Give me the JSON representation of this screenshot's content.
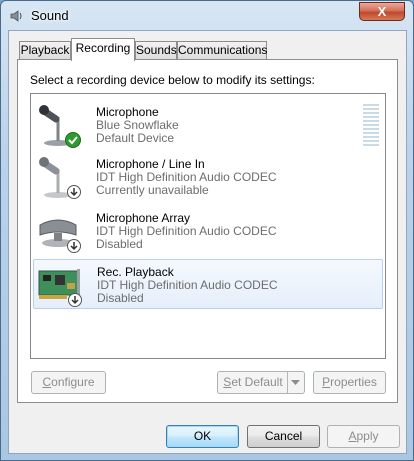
{
  "window": {
    "title": "Sound",
    "close_glyph": "X"
  },
  "tabs": [
    {
      "label": "Playback",
      "active": false
    },
    {
      "label": "Recording",
      "active": true
    },
    {
      "label": "Sounds",
      "active": false
    },
    {
      "label": "Communications",
      "active": false
    }
  ],
  "panel": {
    "instruction": "Select a recording device below to modify its settings:"
  },
  "devices": [
    {
      "name": "Microphone",
      "line1": "Blue Snowflake",
      "line2": "Default Device",
      "icon": "microphone-icon",
      "badge": "default-check-icon",
      "selected": false
    },
    {
      "name": "Microphone / Line In",
      "line1": "IDT High Definition Audio CODEC",
      "line2": "Currently unavailable",
      "icon": "microphone-icon",
      "badge": "down-arrow-icon",
      "selected": false
    },
    {
      "name": "Microphone Array",
      "line1": "IDT High Definition Audio CODEC",
      "line2": "Disabled",
      "icon": "microphone-array-icon",
      "badge": "down-arrow-icon",
      "selected": false
    },
    {
      "name": "Rec. Playback",
      "line1": "IDT High Definition Audio CODEC",
      "line2": "Disabled",
      "icon": "sound-card-icon",
      "badge": "down-arrow-icon",
      "selected": true
    }
  ],
  "buttons": {
    "configure": {
      "label": "Configure",
      "mnemonic": "C",
      "rest": "onfigure"
    },
    "set_default": {
      "label": "Set Default",
      "mnemonic": "S",
      "rest": "et Default"
    },
    "properties": {
      "label": "Properties",
      "mnemonic": "P",
      "rest": "roperties"
    },
    "ok": "OK",
    "cancel": "Cancel",
    "apply": {
      "label": "Apply",
      "mnemonic": "A",
      "rest": "pply"
    }
  },
  "colors": {
    "accent_check": "#2e9b2e",
    "level_meter": "#c8dbe6",
    "selection": "#e5eefa"
  }
}
